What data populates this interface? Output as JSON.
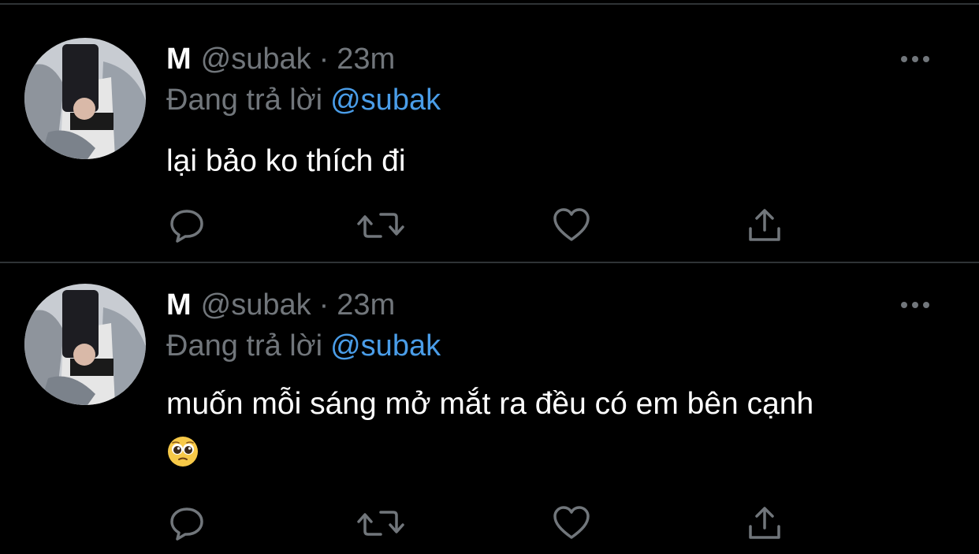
{
  "theme": {
    "background": "#000000",
    "text_primary": "#ffffff",
    "text_secondary": "#71767b",
    "link": "#4a9de8",
    "divider": "#2f3336",
    "icon": "#71767b"
  },
  "tweets": [
    {
      "display_name": "M",
      "handle": "@subak",
      "separator": "·",
      "time": "23m",
      "reply_prefix": "Đang trả lời",
      "reply_to": "@subak",
      "text": "lại bảo ko thích đi",
      "emoji": "",
      "actions": [
        {
          "name": "reply",
          "icon": "speech-bubble-icon"
        },
        {
          "name": "retweet",
          "icon": "retweet-arrows-icon"
        },
        {
          "name": "like",
          "icon": "heart-icon"
        },
        {
          "name": "share",
          "icon": "share-upload-icon"
        }
      ],
      "more_icon": "ellipsis-icon"
    },
    {
      "display_name": "M",
      "handle": "@subak",
      "separator": "·",
      "time": "23m",
      "reply_prefix": "Đang trả lời",
      "reply_to": "@subak",
      "text": "muốn mỗi sáng mở mắt ra đều có em bên cạnh",
      "emoji": "pleading-face-emoji",
      "actions": [
        {
          "name": "reply",
          "icon": "speech-bubble-icon"
        },
        {
          "name": "retweet",
          "icon": "retweet-arrows-icon"
        },
        {
          "name": "like",
          "icon": "heart-icon"
        },
        {
          "name": "share",
          "icon": "share-upload-icon"
        }
      ],
      "more_icon": "ellipsis-icon"
    }
  ]
}
